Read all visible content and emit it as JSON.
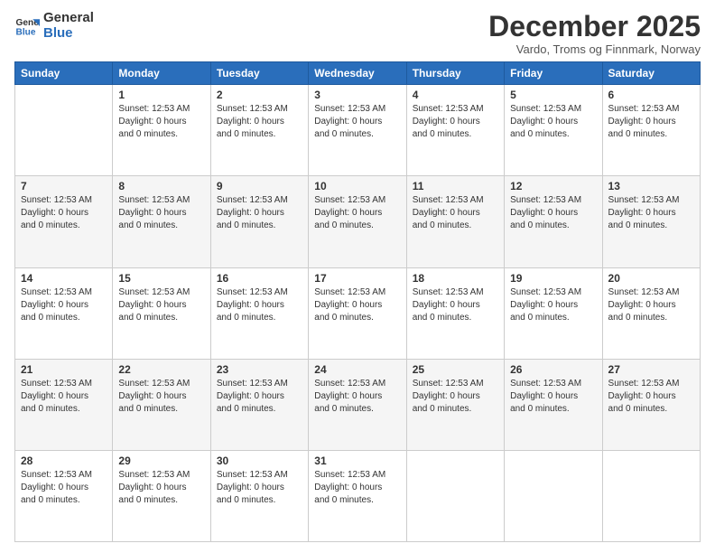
{
  "logo": {
    "line1": "General",
    "line2": "Blue"
  },
  "title": "December 2025",
  "subtitle": "Vardo, Troms og Finnmark, Norway",
  "days_header": [
    "Sunday",
    "Monday",
    "Tuesday",
    "Wednesday",
    "Thursday",
    "Friday",
    "Saturday"
  ],
  "cell_info": "Sunset: 12:53 AM\nDaylight: 0 hours and 0 minutes.",
  "weeks": [
    [
      {
        "day": "",
        "info": ""
      },
      {
        "day": "1",
        "info": "Sunset: 12:53 AM\nDaylight: 0 hours\nand 0 minutes."
      },
      {
        "day": "2",
        "info": "Sunset: 12:53 AM\nDaylight: 0 hours\nand 0 minutes."
      },
      {
        "day": "3",
        "info": "Sunset: 12:53 AM\nDaylight: 0 hours\nand 0 minutes."
      },
      {
        "day": "4",
        "info": "Sunset: 12:53 AM\nDaylight: 0 hours\nand 0 minutes."
      },
      {
        "day": "5",
        "info": "Sunset: 12:53 AM\nDaylight: 0 hours\nand 0 minutes."
      },
      {
        "day": "6",
        "info": "Sunset: 12:53 AM\nDaylight: 0 hours\nand 0 minutes."
      }
    ],
    [
      {
        "day": "7",
        "info": "Sunset: 12:53 AM\nDaylight: 0 hours\nand 0 minutes."
      },
      {
        "day": "8",
        "info": "Sunset: 12:53 AM\nDaylight: 0 hours\nand 0 minutes."
      },
      {
        "day": "9",
        "info": "Sunset: 12:53 AM\nDaylight: 0 hours\nand 0 minutes."
      },
      {
        "day": "10",
        "info": "Sunset: 12:53 AM\nDaylight: 0 hours\nand 0 minutes."
      },
      {
        "day": "11",
        "info": "Sunset: 12:53 AM\nDaylight: 0 hours\nand 0 minutes."
      },
      {
        "day": "12",
        "info": "Sunset: 12:53 AM\nDaylight: 0 hours\nand 0 minutes."
      },
      {
        "day": "13",
        "info": "Sunset: 12:53 AM\nDaylight: 0 hours\nand 0 minutes."
      }
    ],
    [
      {
        "day": "14",
        "info": "Sunset: 12:53 AM\nDaylight: 0 hours\nand 0 minutes."
      },
      {
        "day": "15",
        "info": "Sunset: 12:53 AM\nDaylight: 0 hours\nand 0 minutes."
      },
      {
        "day": "16",
        "info": "Sunset: 12:53 AM\nDaylight: 0 hours\nand 0 minutes."
      },
      {
        "day": "17",
        "info": "Sunset: 12:53 AM\nDaylight: 0 hours\nand 0 minutes."
      },
      {
        "day": "18",
        "info": "Sunset: 12:53 AM\nDaylight: 0 hours\nand 0 minutes."
      },
      {
        "day": "19",
        "info": "Sunset: 12:53 AM\nDaylight: 0 hours\nand 0 minutes."
      },
      {
        "day": "20",
        "info": "Sunset: 12:53 AM\nDaylight: 0 hours\nand 0 minutes."
      }
    ],
    [
      {
        "day": "21",
        "info": "Sunset: 12:53 AM\nDaylight: 0 hours\nand 0 minutes."
      },
      {
        "day": "22",
        "info": "Sunset: 12:53 AM\nDaylight: 0 hours\nand 0 minutes."
      },
      {
        "day": "23",
        "info": "Sunset: 12:53 AM\nDaylight: 0 hours\nand 0 minutes."
      },
      {
        "day": "24",
        "info": "Sunset: 12:53 AM\nDaylight: 0 hours\nand 0 minutes."
      },
      {
        "day": "25",
        "info": "Sunset: 12:53 AM\nDaylight: 0 hours\nand 0 minutes."
      },
      {
        "day": "26",
        "info": "Sunset: 12:53 AM\nDaylight: 0 hours\nand 0 minutes."
      },
      {
        "day": "27",
        "info": "Sunset: 12:53 AM\nDaylight: 0 hours\nand 0 minutes."
      }
    ],
    [
      {
        "day": "28",
        "info": "Sunset: 12:53 AM\nDaylight: 0 hours\nand 0 minutes."
      },
      {
        "day": "29",
        "info": "Sunset: 12:53 AM\nDaylight: 0 hours\nand 0 minutes."
      },
      {
        "day": "30",
        "info": "Sunset: 12:53 AM\nDaylight: 0 hours\nand 0 minutes."
      },
      {
        "day": "31",
        "info": "Sunset: 12:53 AM\nDaylight: 0 hours\nand 0 minutes."
      },
      {
        "day": "",
        "info": ""
      },
      {
        "day": "",
        "info": ""
      },
      {
        "day": "",
        "info": ""
      }
    ]
  ]
}
